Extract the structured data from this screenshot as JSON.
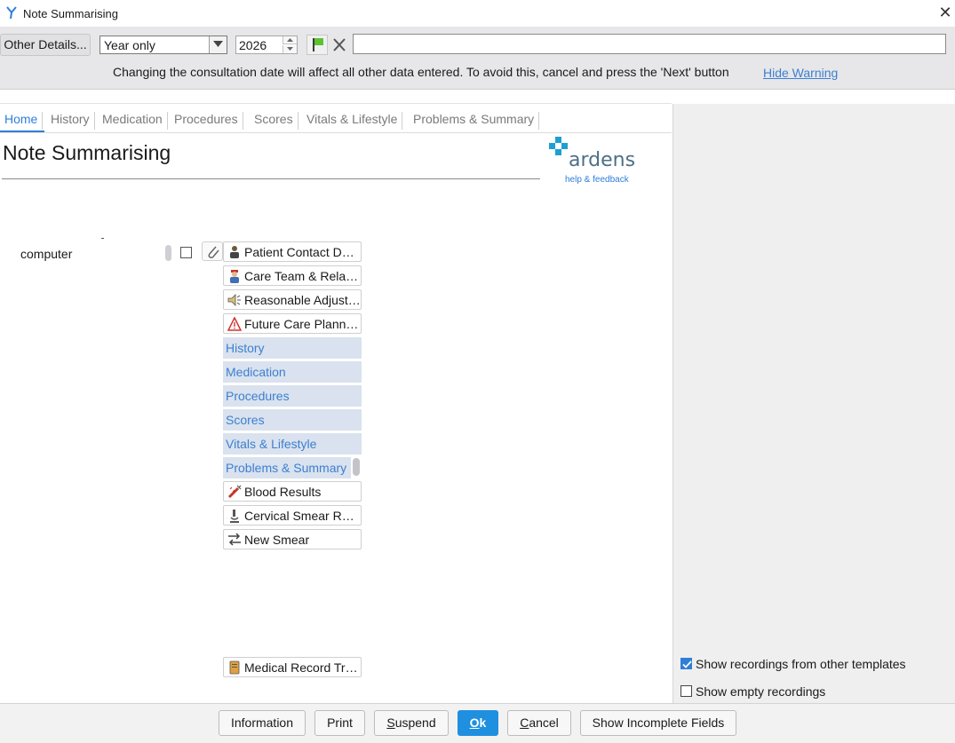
{
  "window": {
    "title": "Note Summarising",
    "close_glyph": "✕"
  },
  "toolbar": {
    "other_details_label": "Other Details...",
    "date_mode_value": "Year only",
    "year_value": "2026",
    "notes_value": "",
    "warning_text": "Changing the consultation date will affect all other data entered. To avoid this, cancel and press the 'Next' button",
    "hide_warning_label": "Hide Warning"
  },
  "tabs": [
    {
      "label": "Home",
      "active": true
    },
    {
      "label": "History"
    },
    {
      "label": "Medication"
    },
    {
      "label": "Procedures"
    },
    {
      "label": "Scores"
    },
    {
      "label": "Vitals & Lifestyle"
    },
    {
      "label": "Problems & Summary"
    }
  ],
  "page": {
    "title": "Note Summarising",
    "brand_name": "ardens",
    "brand_link": "help & feedback",
    "field_label": "computer"
  },
  "nav": {
    "items": [
      {
        "label": "Patient Contact Details",
        "icon": "person-icon"
      },
      {
        "label": "Care Team & Relationships",
        "icon": "doctor-icon"
      },
      {
        "label": "Reasonable Adjustments",
        "icon": "speaker-icon"
      },
      {
        "label": "Future Care Planning",
        "icon": "warning-icon"
      }
    ],
    "sections": [
      {
        "label": "History"
      },
      {
        "label": "Medication"
      },
      {
        "label": "Procedures"
      },
      {
        "label": "Scores"
      },
      {
        "label": "Vitals & Lifestyle"
      },
      {
        "label": "Problems & Summary"
      }
    ],
    "after_items": [
      {
        "label": "Blood Results",
        "icon": "syringe-icon"
      },
      {
        "label": "Cervical Smear Results",
        "icon": "microscope-icon"
      },
      {
        "label": "New Smear",
        "icon": "transfer-icon"
      }
    ],
    "bottom_item": {
      "label": "Medical Record Transfer",
      "icon": "document-icon"
    }
  },
  "options": {
    "show_other_templates": {
      "label": "Show recordings from other templates",
      "checked": true
    },
    "show_empty": {
      "label": "Show empty recordings",
      "checked": false
    }
  },
  "footer": {
    "information": "Information",
    "print": "Print",
    "suspend_first": "S",
    "suspend_rest": "uspend",
    "ok_first": "O",
    "ok_rest": "k",
    "cancel_first": "C",
    "cancel_rest": "ancel",
    "show_incomplete": "Show Incomplete Fields"
  },
  "colors": {
    "accent": "#2f7ed8",
    "ok_button": "#1f8fe0",
    "section_bg": "#d9e2ee",
    "toolbar_bg": "#e7e7e9",
    "brand_teal": "#1e9fd2"
  }
}
